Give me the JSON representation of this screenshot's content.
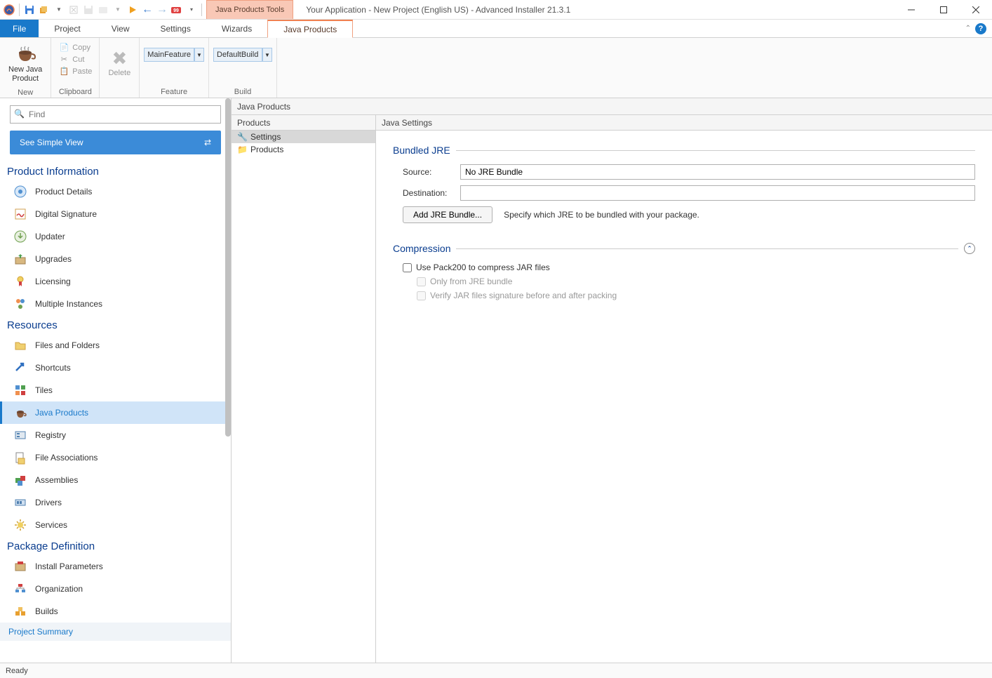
{
  "title_tools_tab": "Java Products Tools",
  "window_title": "Your Application - New Project (English US) - Advanced Installer 21.3.1",
  "tabs": {
    "file": "File",
    "project": "Project",
    "view": "View",
    "settings": "Settings",
    "wizards": "Wizards",
    "java_products": "Java Products"
  },
  "ribbon": {
    "new_java_product": "New Java\nProduct",
    "new_group": "New",
    "copy": "Copy",
    "cut": "Cut",
    "paste": "Paste",
    "clipboard_group": "Clipboard",
    "delete": "Delete",
    "main_feature": "MainFeature",
    "feature_group": "Feature",
    "default_build": "DefaultBuild",
    "build_group": "Build"
  },
  "search_placeholder": "Find",
  "simple_view": "See Simple View",
  "nav": {
    "product_information": "Product Information",
    "product_details": "Product Details",
    "digital_signature": "Digital Signature",
    "updater": "Updater",
    "upgrades": "Upgrades",
    "licensing": "Licensing",
    "multiple_instances": "Multiple Instances",
    "resources": "Resources",
    "files_and_folders": "Files and Folders",
    "shortcuts": "Shortcuts",
    "tiles": "Tiles",
    "java_products": "Java Products",
    "registry": "Registry",
    "file_associations": "File Associations",
    "assemblies": "Assemblies",
    "drivers": "Drivers",
    "services": "Services",
    "package_definition": "Package Definition",
    "install_parameters": "Install Parameters",
    "organization": "Organization",
    "builds": "Builds",
    "project_summary": "Project Summary"
  },
  "breadcrumb": "Java Products",
  "products_panel_title": "Products",
  "tree": {
    "settings": "Settings",
    "products": "Products"
  },
  "java_settings_title": "Java Settings",
  "sections": {
    "bundled_jre": "Bundled JRE",
    "source_label": "Source:",
    "source_value": "No JRE Bundle",
    "destination_label": "Destination:",
    "destination_value": "",
    "add_jre_btn": "Add JRE Bundle...",
    "add_jre_hint": "Specify which JRE to be bundled with your package.",
    "compression": "Compression",
    "use_pack200": "Use Pack200 to compress JAR files",
    "only_from_jre": "Only from JRE bundle",
    "verify_signature": "Verify JAR files signature before and after packing"
  },
  "status": "Ready"
}
